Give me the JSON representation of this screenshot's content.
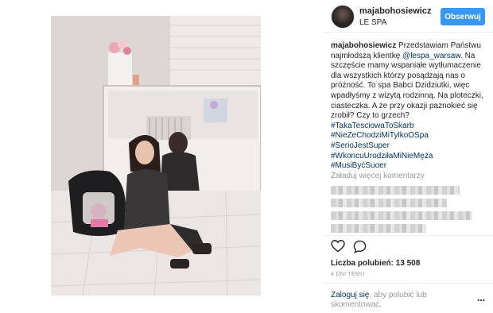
{
  "header": {
    "username": "majabohosiewicz",
    "location": "LE SPA",
    "follow_label": "Obserwuj"
  },
  "post_image": {
    "description_icon": "photo"
  },
  "caption": {
    "username": "majabohosiewicz",
    "text_1": " Przedstawiam Państwu najmłodszą klientkę ",
    "mention": "@lespa_warsaw",
    "text_2": ". Na szczęście mamy wspaniałe wytłumaczenie dla wszystkich którzy posądzają nas o próżność. To spa Babci Dzidziutki, więc wpadłyśmy z wizytą rodzinną. Na ploteczki, ciasteczka. A że przy okazji paznokieć się zrobił? Czy to grzech? ",
    "hashtags": [
      "#TakaTesciowaToSkarb",
      "#NieZeChodziMiTylkoOSpa",
      "#SerioJestSuper",
      "#WkoncuUrodziłaMiNieMęża",
      "#MusiByćSuoer"
    ]
  },
  "comments": {
    "load_more": "Załaduj więcej komentarzy"
  },
  "actions": {
    "like_icon": "heart-icon",
    "comment_icon": "comment-icon"
  },
  "likes": {
    "text": "Liczba polubień: 13 508"
  },
  "timestamp": "4 DNI TEMU",
  "login": {
    "link": "Zaloguj się",
    "rest": ", aby polubić lub skomentować."
  },
  "colors": {
    "accent": "#3897f0",
    "link": "#003569",
    "muted": "#999999"
  }
}
